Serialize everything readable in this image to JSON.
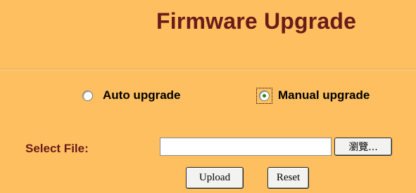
{
  "header": {
    "title": "Firmware Upgrade"
  },
  "upgrade_mode": {
    "options": [
      {
        "label": "Auto upgrade",
        "checked": false
      },
      {
        "label": "Manual upgrade",
        "checked": true
      }
    ]
  },
  "file_select": {
    "label": "Select File:",
    "value": "",
    "browse_label": "瀏覽..."
  },
  "actions": {
    "upload_label": "Upload",
    "reset_label": "Reset"
  },
  "colors": {
    "background": "#fdbf5f",
    "title_text": "#6a1a1a",
    "radio_dot": "#1e8a1e"
  }
}
